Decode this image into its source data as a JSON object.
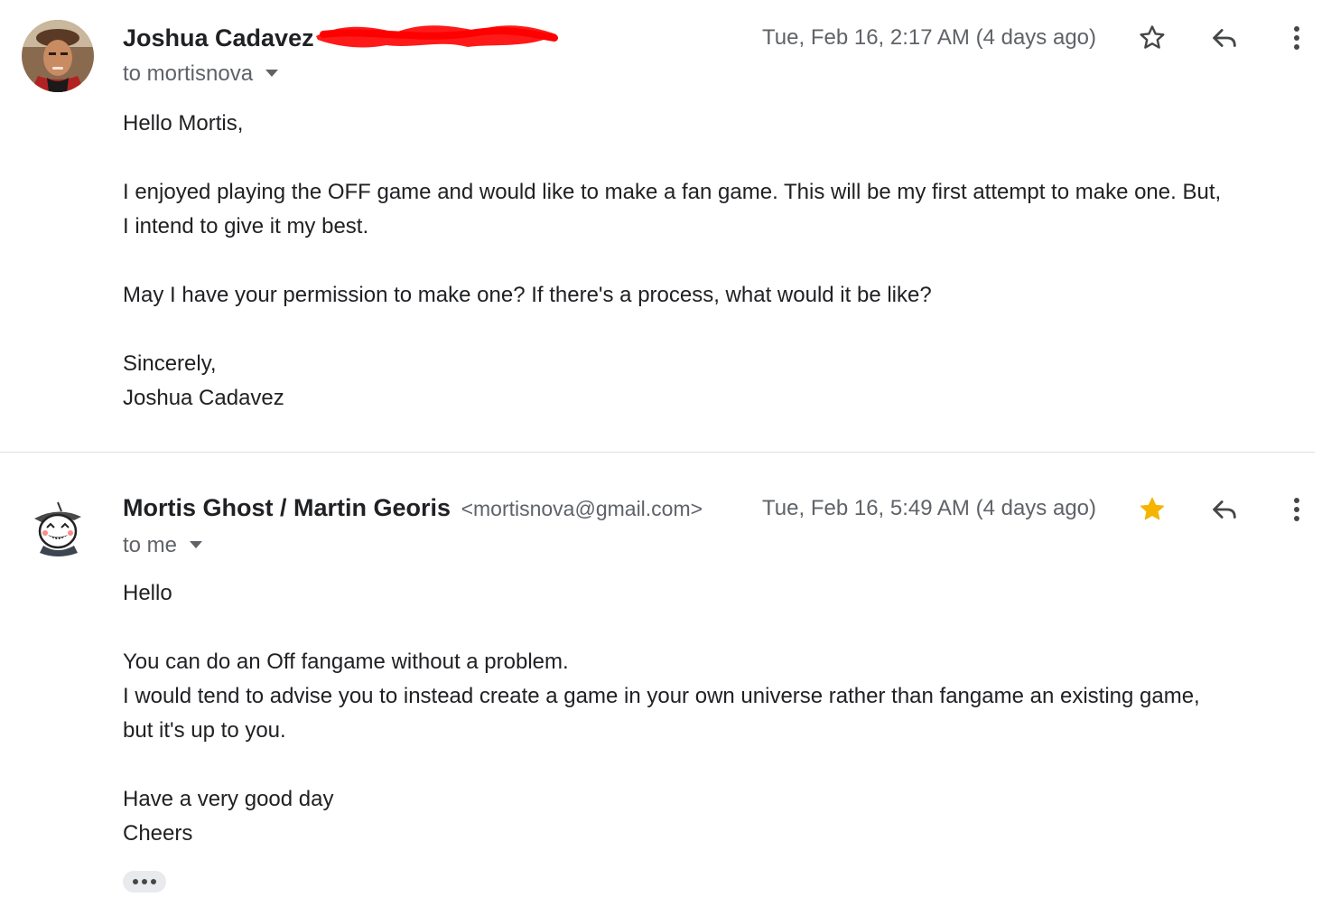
{
  "messages": [
    {
      "sender_name": "Joshua Cadavez",
      "sender_email": "",
      "recipient": "to mortisnova",
      "timestamp": "Tue, Feb 16, 2:17 AM (4 days ago)",
      "starred": false,
      "body": {
        "greeting": "Hello Mortis,",
        "para1_line1": "I enjoyed playing the OFF game and would like to make a fan game. This will be my first attempt to make one. But,",
        "para1_line2": "I intend to give it my best.",
        "para2": "May I have your permission to make one? If there's a process, what would it be like?",
        "signoff": "Sincerely,",
        "signature": "Joshua Cadavez"
      }
    },
    {
      "sender_name": "Mortis Ghost / Martin Georis",
      "sender_email": "<mortisnova@gmail.com>",
      "recipient": "to me",
      "timestamp": "Tue, Feb 16, 5:49 AM (4 days ago)",
      "starred": true,
      "body": {
        "greeting": "Hello",
        "para1": "You can do an Off fangame without a problem.",
        "para2_line1": "I would tend to advise you to instead create a game in your own universe rather than fangame an existing game,",
        "para2_line2": "but it's up to you.",
        "closing1": "Have a very good day",
        "closing2": "Cheers"
      }
    }
  ],
  "icons": {
    "star_empty": "star-outline-icon",
    "star_filled": "star-filled-icon",
    "reply": "reply-icon",
    "more": "more-vertical-icon",
    "trimmed": "show-trimmed-content-icon"
  },
  "colors": {
    "text_primary": "#202124",
    "text_secondary": "#5f6368",
    "star_filled": "#f4b400",
    "redaction": "#ff0000"
  }
}
